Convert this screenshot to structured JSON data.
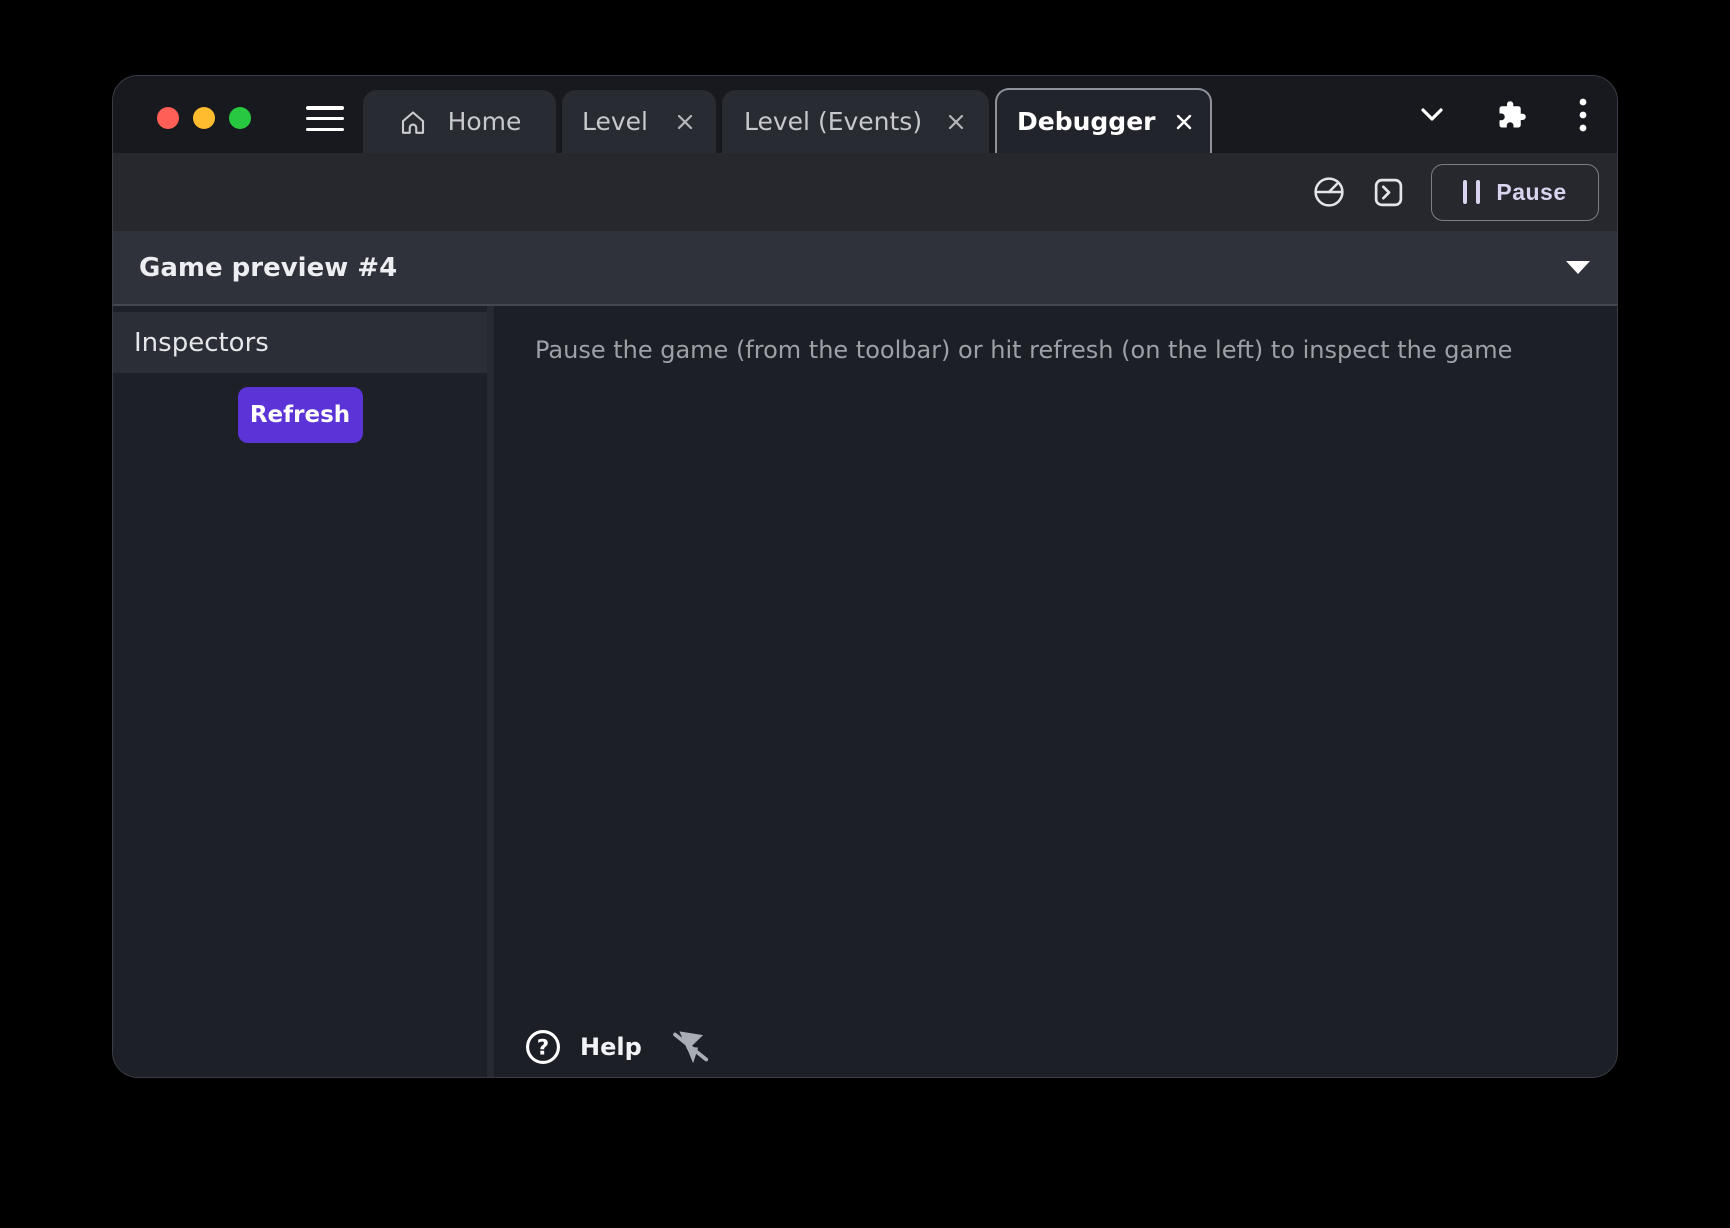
{
  "title_bar": {
    "tabs": [
      {
        "label": "Home",
        "active": false,
        "closable": false
      },
      {
        "label": "Level",
        "active": false,
        "closable": true
      },
      {
        "label": "Level (Events)",
        "active": false,
        "closable": true
      },
      {
        "label": "Debugger",
        "active": true,
        "closable": true
      }
    ],
    "traffic_lights": [
      "close",
      "minimize",
      "zoom"
    ]
  },
  "toolbar": {
    "pause_label": "Pause",
    "icons": [
      "profiler-icon",
      "console-icon"
    ]
  },
  "preview_bar": {
    "title": "Game preview #4"
  },
  "sidebar": {
    "title": "Inspectors",
    "refresh_label": "Refresh"
  },
  "content": {
    "message": "Pause the game (from the toolbar) or hit refresh (on the left) to inspect the game",
    "help_label": "Help"
  },
  "icons": {
    "tab_home": "home-icon",
    "tab_close": "close-icon",
    "menu": "hamburger-icon",
    "tab_overflow": "chevron-down-icon",
    "extensions": "puzzle-icon",
    "more": "kebab-menu-icon",
    "profiler": "profiler-icon",
    "console": "console-icon",
    "pause": "pause-icon",
    "preview_dropdown": "caret-down-icon",
    "help": "help-circle-icon",
    "pin_off": "pin-off-icon"
  },
  "colors": {
    "window_bg": "#1e2027",
    "titlebar_bg": "#17191e",
    "toolbar_bg": "#26282e",
    "preview_row_bg": "#2f323a",
    "main_bg": "#1d1f26",
    "inspectors_header_bg": "#2b2e36",
    "accent_purple": "#5c33d6",
    "pause_tint": "#d9d3f0",
    "traffic_red": "#ff5f57",
    "traffic_yellow": "#febc2e",
    "traffic_green": "#28c840"
  }
}
